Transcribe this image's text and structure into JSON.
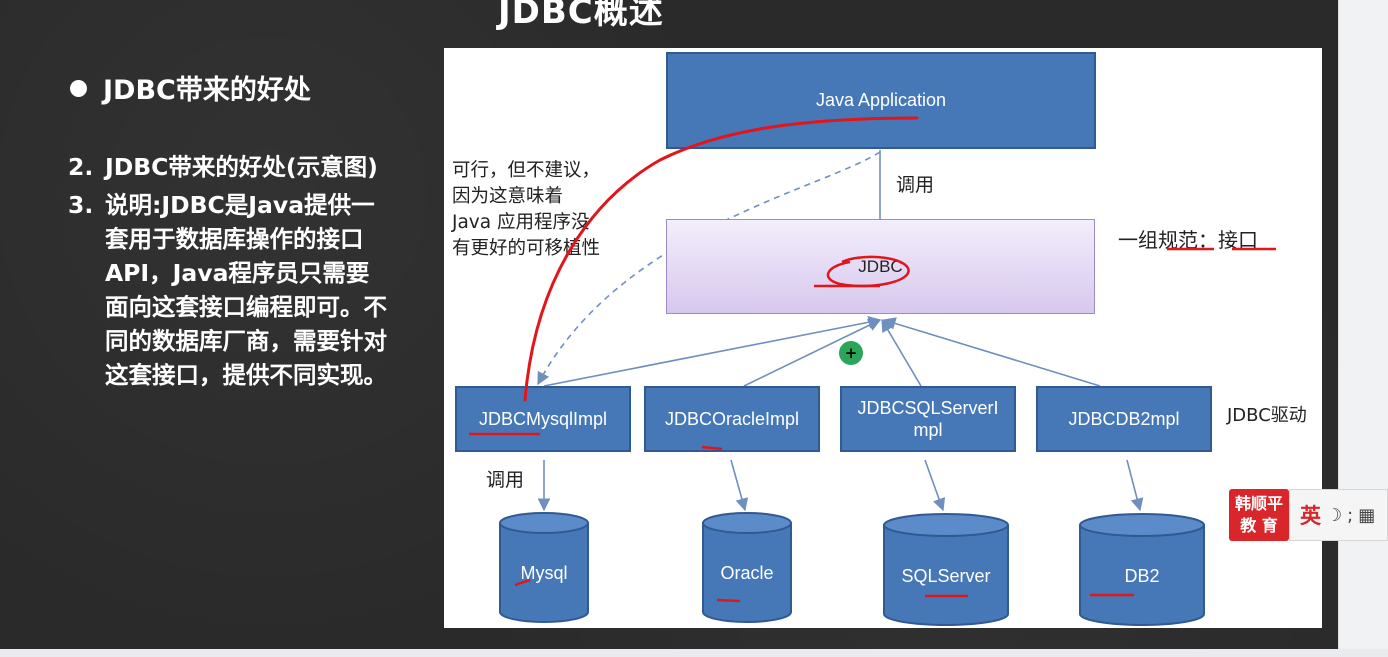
{
  "slide": {
    "title": "JDBC概述",
    "bullet_heading": "JDBC带来的好处",
    "points": [
      {
        "num": "2.",
        "text": "JDBC带来的好处(示意图)"
      },
      {
        "num": "3.",
        "text": "说明:JDBC是Java提供一套用于数据库操作的接口API，Java程序员只需要面向这套接口编程即可。不同的数据库厂商，需要针对这套接口，提供不同实现。"
      }
    ]
  },
  "diagram": {
    "app_box": "Java Application",
    "call_label_top": "调用",
    "jdbc_box": "JDBC",
    "spec_label": "一组规范：接口",
    "side_note": "可行，但不建议，因为这意味着 Java 应用程序没有更好的可移植性",
    "driver_label": "JDBC驱动",
    "impls": [
      "JDBCMysqlImpl",
      "JDBCOracleImpl",
      "JDBCSQLServerImpl",
      "JDBCDB2mpl"
    ],
    "impl_sqlserver_lines": [
      "JDBCSQLServerI",
      "mpl"
    ],
    "call_label_bottom": "调用",
    "databases": [
      "Mysql",
      "Oracle",
      "SQLServer",
      "DB2"
    ],
    "colors": {
      "box_fill": "#4678b8",
      "annotation_red": "#e0161b",
      "arrow": "#6f8fbf"
    }
  },
  "overlay": {
    "cursor_symbol": "+",
    "logo_text": [
      "韩顺平",
      "教 育"
    ],
    "ime_language": "英",
    "ime_icons": [
      "moon-icon",
      "punctuation-icon",
      "keyboard-icon"
    ]
  }
}
